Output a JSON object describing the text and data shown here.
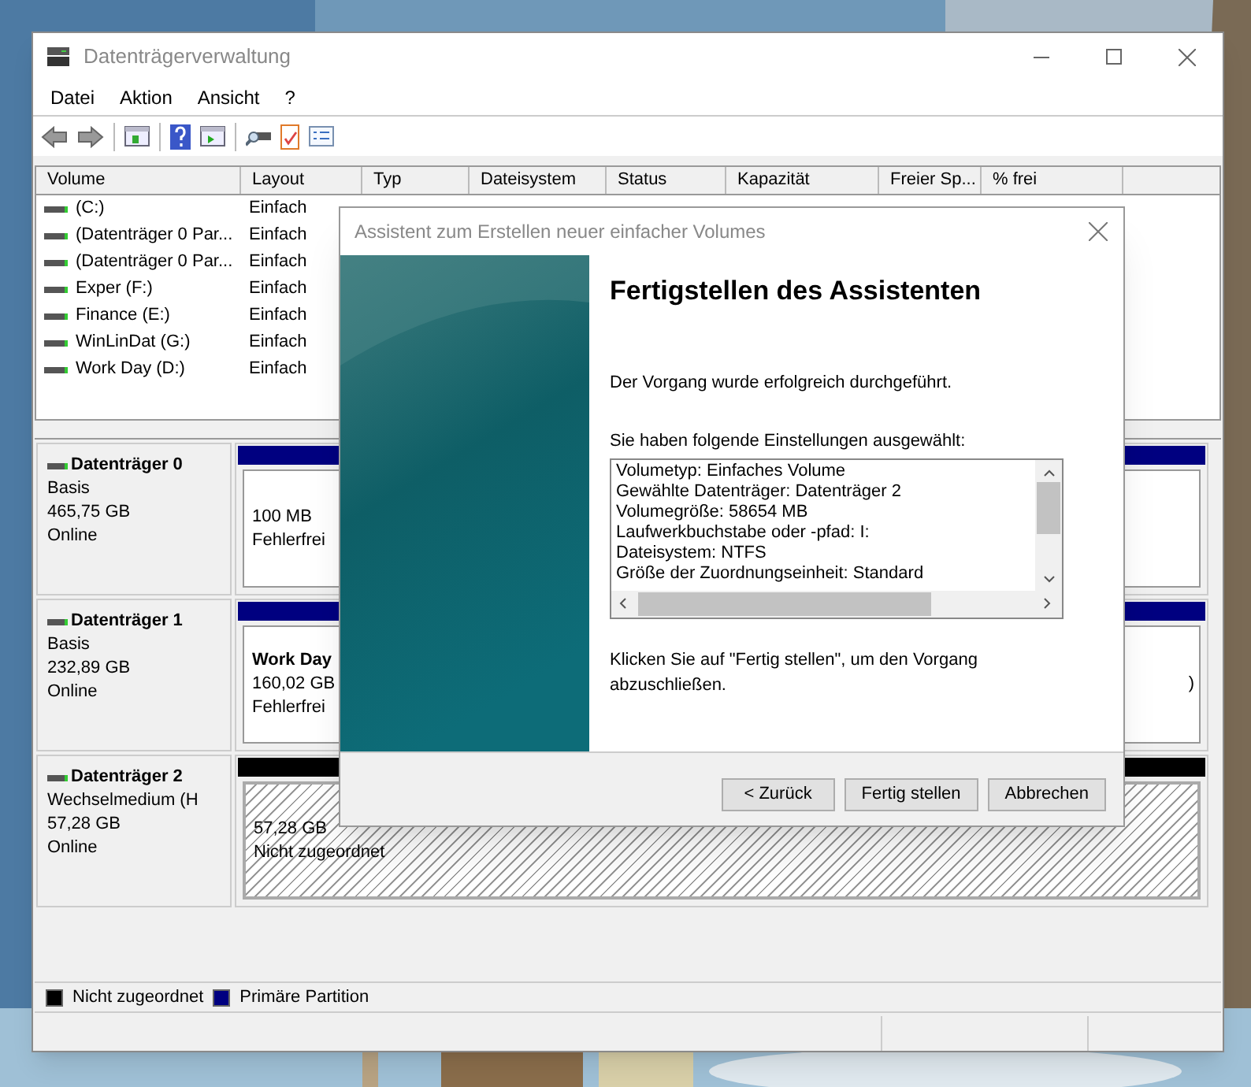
{
  "window": {
    "title": "Datenträgerverwaltung"
  },
  "menu": [
    "Datei",
    "Aktion",
    "Ansicht",
    "?"
  ],
  "table": {
    "columns": [
      "Volume",
      "Layout",
      "Typ",
      "Dateisystem",
      "Status",
      "Kapazität",
      "Freier Sp...",
      "% frei"
    ],
    "rows": [
      {
        "cells": [
          "(C:)",
          "Einfach"
        ]
      },
      {
        "cells": [
          "(Datenträger 0 Par...",
          "Einfach"
        ]
      },
      {
        "cells": [
          "(Datenträger 0 Par...",
          "Einfach"
        ]
      },
      {
        "cells": [
          "Exper (F:)",
          "Einfach"
        ]
      },
      {
        "cells": [
          "Finance (E:)",
          "Einfach"
        ]
      },
      {
        "cells": [
          "WinLinDat (G:)",
          "Einfach"
        ]
      },
      {
        "cells": [
          "Work Day (D:)",
          "Einfach"
        ]
      }
    ]
  },
  "disks": [
    {
      "name": "Datenträger 0",
      "lines": [
        "Basis",
        "465,75 GB",
        "Online"
      ],
      "partitions": [
        {
          "kind": "primary",
          "lines": [
            "100 MB",
            "Fehlerfrei"
          ]
        },
        {
          "kind": "primary"
        }
      ]
    },
    {
      "name": "Datenträger 1",
      "lines": [
        "Basis",
        "232,89 GB",
        "Online"
      ],
      "partitions": [
        {
          "kind": "primary",
          "title": "Work Day",
          "lines": [
            "160,02 GB",
            "Fehlerfrei"
          ]
        },
        {
          "kind": "primary",
          "lines": [
            ")"
          ]
        }
      ]
    },
    {
      "name": "Datenträger 2",
      "lines": [
        "Wechselmedium (H",
        "57,28 GB",
        "Online"
      ],
      "partitions": [
        {
          "kind": "unallocated",
          "lines": [
            "57,28 GB",
            "Nicht zugeordnet"
          ]
        }
      ]
    }
  ],
  "legend": [
    {
      "label": "Nicht zugeordnet",
      "color": "#000000"
    },
    {
      "label": "Primäre Partition",
      "color": "#000080"
    }
  ],
  "dialog": {
    "title": "Assistent zum Erstellen neuer einfacher Volumes",
    "heading": "Fertigstellen des Assistenten",
    "message": "Der Vorgang wurde erfolgreich durchgeführt.",
    "settings_label": "Sie haben folgende Einstellungen ausgewählt:",
    "settings": [
      "Volumetyp: Einfaches Volume",
      "Gewählte Datenträger: Datenträger 2",
      "Volumegröße: 58654 MB",
      "Laufwerkbuchstabe oder -pfad: I:",
      "Dateisystem: NTFS",
      "Größe der Zuordnungseinheit: Standard"
    ],
    "hint": "Klicken Sie auf \"Fertig stellen\", um den Vorgang abzuschließen.",
    "buttons": [
      "< Zurück",
      "Fertig stellen",
      "Abbrechen"
    ]
  }
}
